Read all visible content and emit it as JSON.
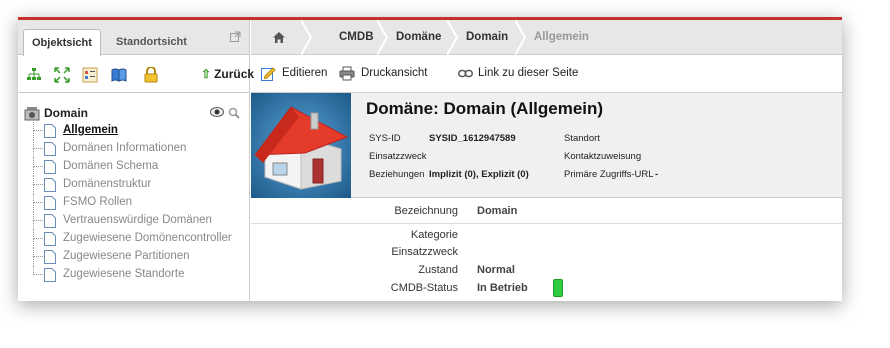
{
  "left_panel": {
    "tabs": [
      "Objektsicht",
      "Standortsicht"
    ],
    "back_label": "Zurück",
    "tree": {
      "root": "Domain",
      "items": [
        "Allgemein",
        "Domänen Informationen",
        "Domänen Schema",
        "Domänenstruktur",
        "FSMO Rollen",
        "Vertrauenswürdige Domänen",
        "Zugewiesene Domönencontroller",
        "Zugewiesene Partitionen",
        "Zugewiesene Standorte"
      ],
      "selected_index": 0
    }
  },
  "breadcrumb": {
    "items": [
      "CMDB",
      "Domäne",
      "Domain",
      "Allgemein"
    ]
  },
  "toolbar": {
    "edit": "Editieren",
    "print": "Druckansicht",
    "link": "Link zu dieser Seite"
  },
  "header": {
    "title": "Domäne: Domain (Allgemein)",
    "sysid_label": "SYS-ID",
    "sysid_value": "SYSID_1612947589",
    "purpose_label": "Einsatzzweck",
    "relations_label": "Beziehungen",
    "relations_value": "Implizit (0), Explizit (0)",
    "location_label": "Standort",
    "contact_label": "Kontaktzuweisung",
    "url_label": "Primäre Zugriffs-URL",
    "url_value": "-"
  },
  "details": {
    "bezeichnung_label": "Bezeichnung",
    "bezeichnung_value": "Domain",
    "kategorie_label": "Kategorie",
    "einsatzzweck_label": "Einsatzzweck",
    "zustand_label": "Zustand",
    "zustand_value": "Normal",
    "cmdb_status_label": "CMDB-Status",
    "cmdb_status_value": "In Betrieb",
    "cmdb_status_color": "#2ecc40"
  },
  "colors": {
    "accent_line": "#c8312b",
    "panel_bg": "#e7e7e7",
    "header_bg": "#f0f0f0"
  }
}
